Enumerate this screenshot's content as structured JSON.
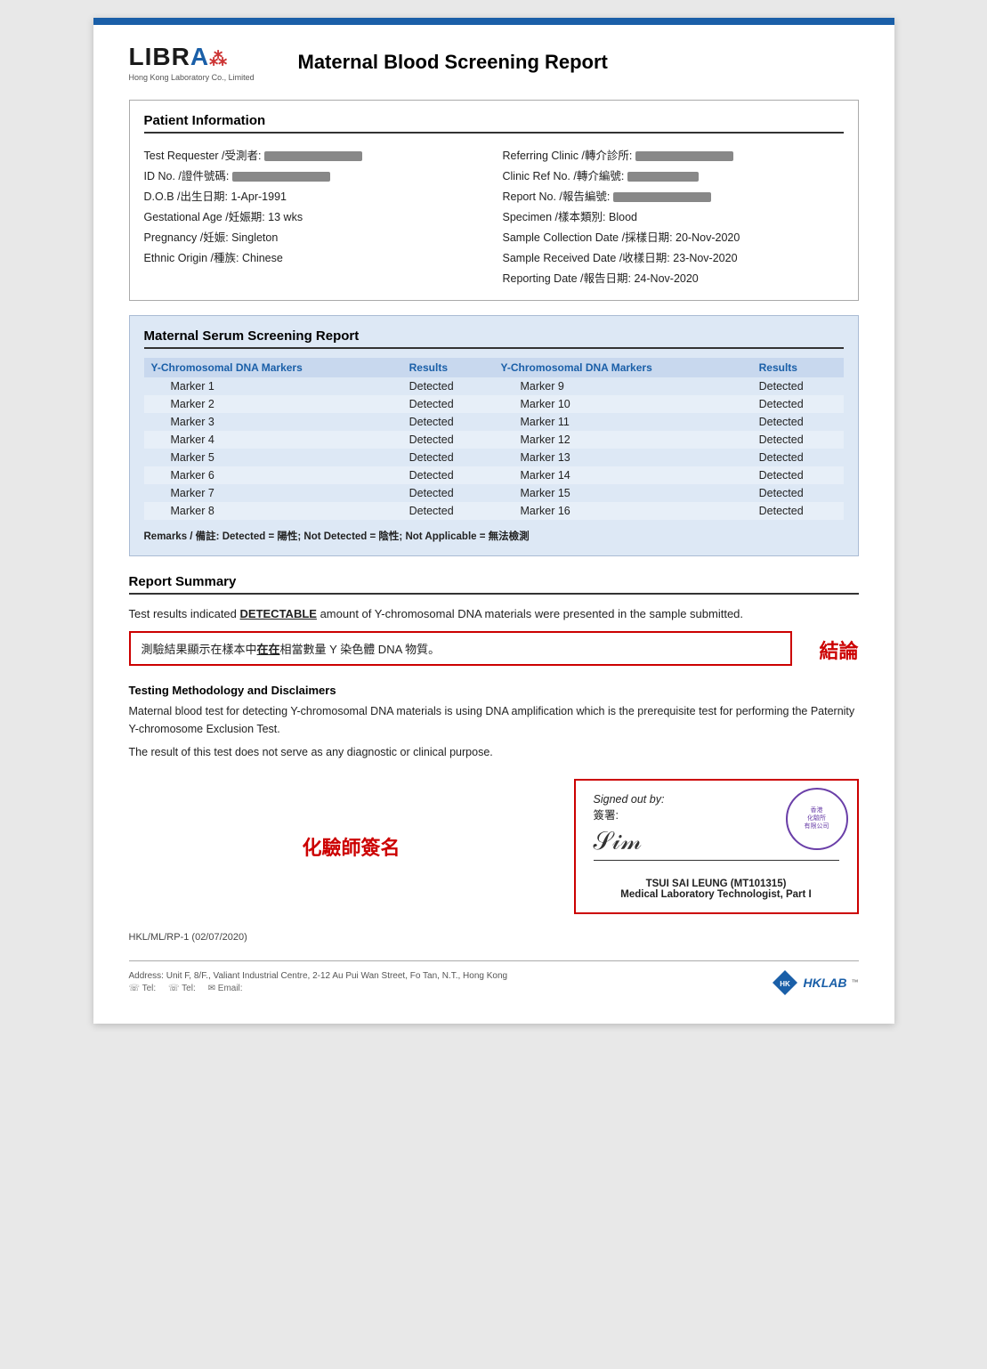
{
  "page": {
    "top_bar_color": "#1a5fa8"
  },
  "header": {
    "logo_text": "LIBRA",
    "logo_sub": "Hong Kong Laboratory Co., Limited",
    "report_title": "Maternal Blood Screening Report"
  },
  "patient_info": {
    "section_heading": "Patient Information",
    "left_fields": [
      {
        "label": "Test Requester /受測者:",
        "value": "REDACTED"
      },
      {
        "label": "ID No. /證件號碼:",
        "value": "REDACTED"
      },
      {
        "label": "D.O.B /出生日期:",
        "value": "1-Apr-1991"
      },
      {
        "label": "Gestational Age /妊娠期:",
        "value": "13 wks"
      },
      {
        "label": "Pregnancy /妊娠:",
        "value": "Singleton"
      },
      {
        "label": "Ethnic Origin /種族:",
        "value": "Chinese"
      }
    ],
    "right_fields": [
      {
        "label": "Referring Clinic /轉介診所:",
        "value": "REDACTED"
      },
      {
        "label": "Clinic Ref No. /轉介編號:",
        "value": "REDACTED"
      },
      {
        "label": "Report No. /報告編號:",
        "value": "REDACTED"
      },
      {
        "label": "Specimen /樣本類別:",
        "value": "Blood"
      },
      {
        "label": "Sample Collection Date /採樣日期:",
        "value": "20-Nov-2020"
      },
      {
        "label": "Sample Received Date /收樣日期:",
        "value": "23-Nov-2020"
      },
      {
        "label": "Reporting Date /報告日期:",
        "value": "24-Nov-2020"
      }
    ]
  },
  "serum_report": {
    "section_heading": "Maternal Serum Screening Report",
    "col1_header": "Y-Chromosomal DNA Markers",
    "col2_header": "Results",
    "col3_header": "Y-Chromosomal DNA Markers",
    "col4_header": "Results",
    "left_markers": [
      {
        "marker": "Marker 1",
        "result": "Detected"
      },
      {
        "marker": "Marker 2",
        "result": "Detected"
      },
      {
        "marker": "Marker 3",
        "result": "Detected"
      },
      {
        "marker": "Marker 4",
        "result": "Detected"
      },
      {
        "marker": "Marker 5",
        "result": "Detected"
      },
      {
        "marker": "Marker 6",
        "result": "Detected"
      },
      {
        "marker": "Marker 7",
        "result": "Detected"
      },
      {
        "marker": "Marker 8",
        "result": "Detected"
      }
    ],
    "right_markers": [
      {
        "marker": "Marker 9",
        "result": "Detected"
      },
      {
        "marker": "Marker 10",
        "result": "Detected"
      },
      {
        "marker": "Marker 11",
        "result": "Detected"
      },
      {
        "marker": "Marker 12",
        "result": "Detected"
      },
      {
        "marker": "Marker 13",
        "result": "Detected"
      },
      {
        "marker": "Marker 14",
        "result": "Detected"
      },
      {
        "marker": "Marker 15",
        "result": "Detected"
      },
      {
        "marker": "Marker 16",
        "result": "Detected"
      }
    ],
    "remarks": "Remarks / 備註: Detected = 陽性; Not Detected = 陰性; Not Applicable = 無法檢測"
  },
  "report_summary": {
    "section_heading": "Report Summary",
    "summary_text_part1": "Test results indicated ",
    "detectable_word": "DETECTABLE",
    "summary_text_part2": " amount of Y-chromosomal DNA materials were presented in the sample submitted.",
    "chinese_summary": "測驗結果顯示在樣本中在在相當數量 Y 染色體 DNA 物質。",
    "conclusion_label": "結論"
  },
  "methodology": {
    "heading": "Testing Methodology and Disclaimers",
    "text1": "Maternal blood test for detecting Y-chromosomal DNA materials is using DNA amplification which is the prerequisite test for performing the Paternity Y-chromosome Exclusion Test.",
    "text2": "The result of this test does not serve as any diagnostic or clinical purpose."
  },
  "signature": {
    "chemist_label": "化驗師簽名",
    "signed_out_label": "Signed out by:",
    "signed_chinese": "簽署:",
    "stamp_text": "香港\n化驗所\n有限公司",
    "signee_name": "TSUI SAI LEUNG (MT101315)",
    "signee_title": "Medical Laboratory Technologist, Part I"
  },
  "footer": {
    "doc_ref": "HKL/ML/RP-1 (02/07/2020)",
    "address": "Address: Unit F, 8/F., Valiant Industrial Centre, 2-12 Au Pui Wan Street, Fo Tan, N.T., Hong Kong",
    "hklab_brand": "HKLAB"
  }
}
